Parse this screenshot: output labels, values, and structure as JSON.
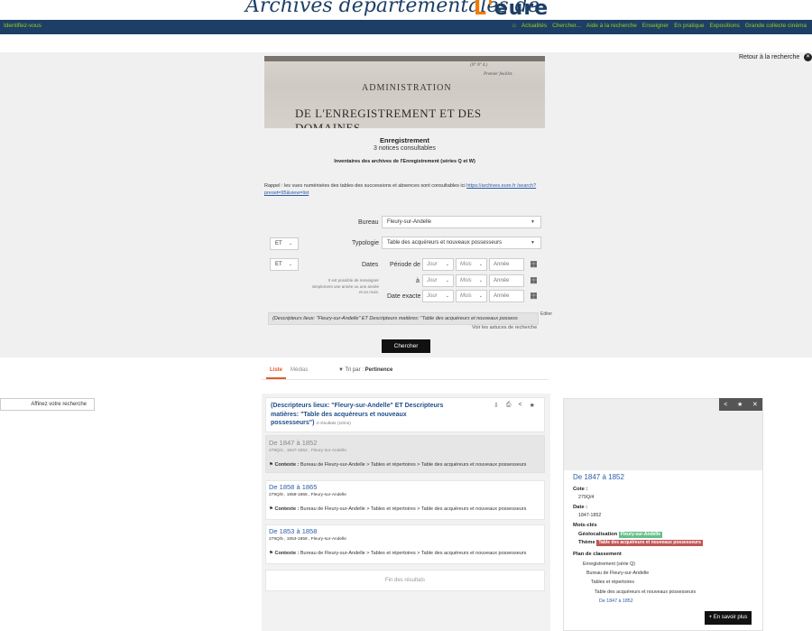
{
  "header": {
    "logo_script": "Archives départementales de",
    "logo_l": "L'",
    "logo_eure": "eure"
  },
  "nav": {
    "login": "Identifiez-vous",
    "home_icon": "home-icon",
    "items": [
      "Actualités",
      "Chercher...",
      "Aide à la recherche",
      "Enseigner",
      "En pratique",
      "Expositions",
      "Grande collecte cinéma"
    ]
  },
  "retour": "Retour à la recherche",
  "banner": {
    "line1": "ADMINISTRATION",
    "line2": "DE L'ENREGISTREMENT ET DES DOMAINES.",
    "corner1": "(Nº Nº 4.)",
    "corner2": "Premier feuillet."
  },
  "collection": {
    "title": "Enregistrement",
    "count": "3 notices consultables",
    "inventory": "Inventaires des archives de l'Enregistrement (séries Q et W)",
    "rappel_text": "Rappel : les vues numérisées des tables des successions et absences sont consultables ici ",
    "rappel_link": "https://archives.eure.fr /search?preset=95&view=list"
  },
  "form": {
    "bureau_label": "Bureau",
    "bureau_value": "Fleury-sur-Andelle",
    "op1": "ET",
    "typologie_label": "Typologie",
    "typologie_value": "Table des acquéreurs et nouveaux possesseurs",
    "op2": "ET",
    "dates_label": "Dates",
    "periode_label": "Période de",
    "a_label": "à",
    "exacte_label": "Date exacte",
    "jour": "Jour",
    "mois": "Mois",
    "annee": "Année",
    "hint": "Il est possible de renseigner simplement une année ou une année et un mois.",
    "query": "(Descripteurs lieux: \"Fleury-sur-Andelle\" ET Descripteurs matières: \"Table des acquéreurs et nouveaux possess",
    "editer": "Editer",
    "astuces": "Voir les astuces de recherche",
    "search_button": "Chercher"
  },
  "tabs": {
    "liste": "Liste",
    "medias": "Médias",
    "sort_prefix": "Tri par :",
    "sort_value": "Pertinence"
  },
  "refine": "Affinez votre recherche",
  "query_card": {
    "title": "(Descripteurs lieux: \"Fleury-sur-Andelle\" ET Descripteurs matières: \"Table des acquéreurs et nouveaux possesseurs\")",
    "count": "3 résultats (10ms)"
  },
  "results": [
    {
      "title": "De 1847 à 1852",
      "meta": "279Q/4 , 1847-1852 , Fleury-sur-Andelle",
      "ctx_label": "Contexte :",
      "ctx": "Bureau de Fleury-sur-Andelle > Tables et répertoires > Table des acquéreurs et nouveaux possesseurs"
    },
    {
      "title": "De 1858 à 1865",
      "meta": "279Q/6 , 1858-1865 , Fleury-sur-Andelle",
      "ctx_label": "Contexte :",
      "ctx": "Bureau de Fleury-sur-Andelle > Tables et répertoires > Table des acquéreurs et nouveaux possesseurs"
    },
    {
      "title": "De 1853 à 1858",
      "meta": "279Q/5 , 1853-1858 , Fleury-sur-Andelle",
      "ctx_label": "Contexte :",
      "ctx": "Bureau de Fleury-sur-Andelle > Tables et répertoires > Table des acquéreurs et nouveaux possesseurs"
    }
  ],
  "fin": "Fin des résultats",
  "detail": {
    "title": "De 1847 à 1852",
    "cote_label": "Cote :",
    "cote": "279Q/4",
    "date_label": "Date :",
    "date": "1847-1852",
    "motscles_label": "Mots-clés",
    "geo_label": "Géolocalisation",
    "geo_tag": "Fleury-sur-Andelle",
    "theme_label": "Thème",
    "theme_tag": "Table des acquéreurs et nouveaux possesseurs",
    "plan_label": "Plan de classement",
    "tree": [
      "Enregistrement (série Q)",
      "Bureau de Fleury-sur-Andelle",
      "Tables et répertoires",
      "Table des acquéreurs et nouveaux possesseurs",
      "De 1847 à 1852"
    ],
    "savoir": "En savoir plus"
  },
  "colors": {
    "navy": "#1d3f66",
    "nav_text": "#9ccc1a",
    "orange": "#f07c00",
    "link": "#2a5ca8",
    "geo_tag": "#66c08a",
    "theme_tag": "#c25555"
  }
}
